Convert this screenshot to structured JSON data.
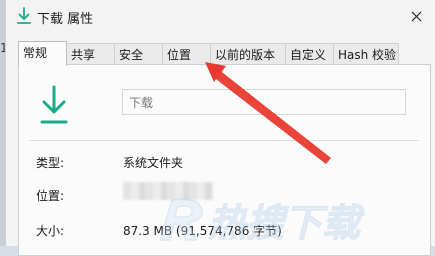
{
  "left_strip": {
    "text": "13"
  },
  "window": {
    "title": "下载 属性",
    "close_icon": "close-icon",
    "title_icon": "download-folder-icon"
  },
  "tabs": [
    {
      "label": "常规",
      "active": true
    },
    {
      "label": "共享",
      "active": false
    },
    {
      "label": "安全",
      "active": false
    },
    {
      "label": "位置",
      "active": false
    },
    {
      "label": "以前的版本",
      "active": false
    },
    {
      "label": "自定义",
      "active": false
    },
    {
      "label": "Hash 校验",
      "active": false
    }
  ],
  "general": {
    "folder_icon": "download-arrow-icon",
    "name_value": "下载",
    "type_label": "类型:",
    "type_value": "系统文件夹",
    "location_label": "位置:",
    "size_label": "大小:",
    "size_value": "87.3 MB (91,574,786 字节)"
  },
  "annotation": {
    "arrow_color": "#e8392f",
    "target": "位置"
  },
  "colors": {
    "download_icon": "#1ca98a",
    "accent_arrow": "#e8392f"
  },
  "watermark": {
    "text": "热搜下载"
  }
}
